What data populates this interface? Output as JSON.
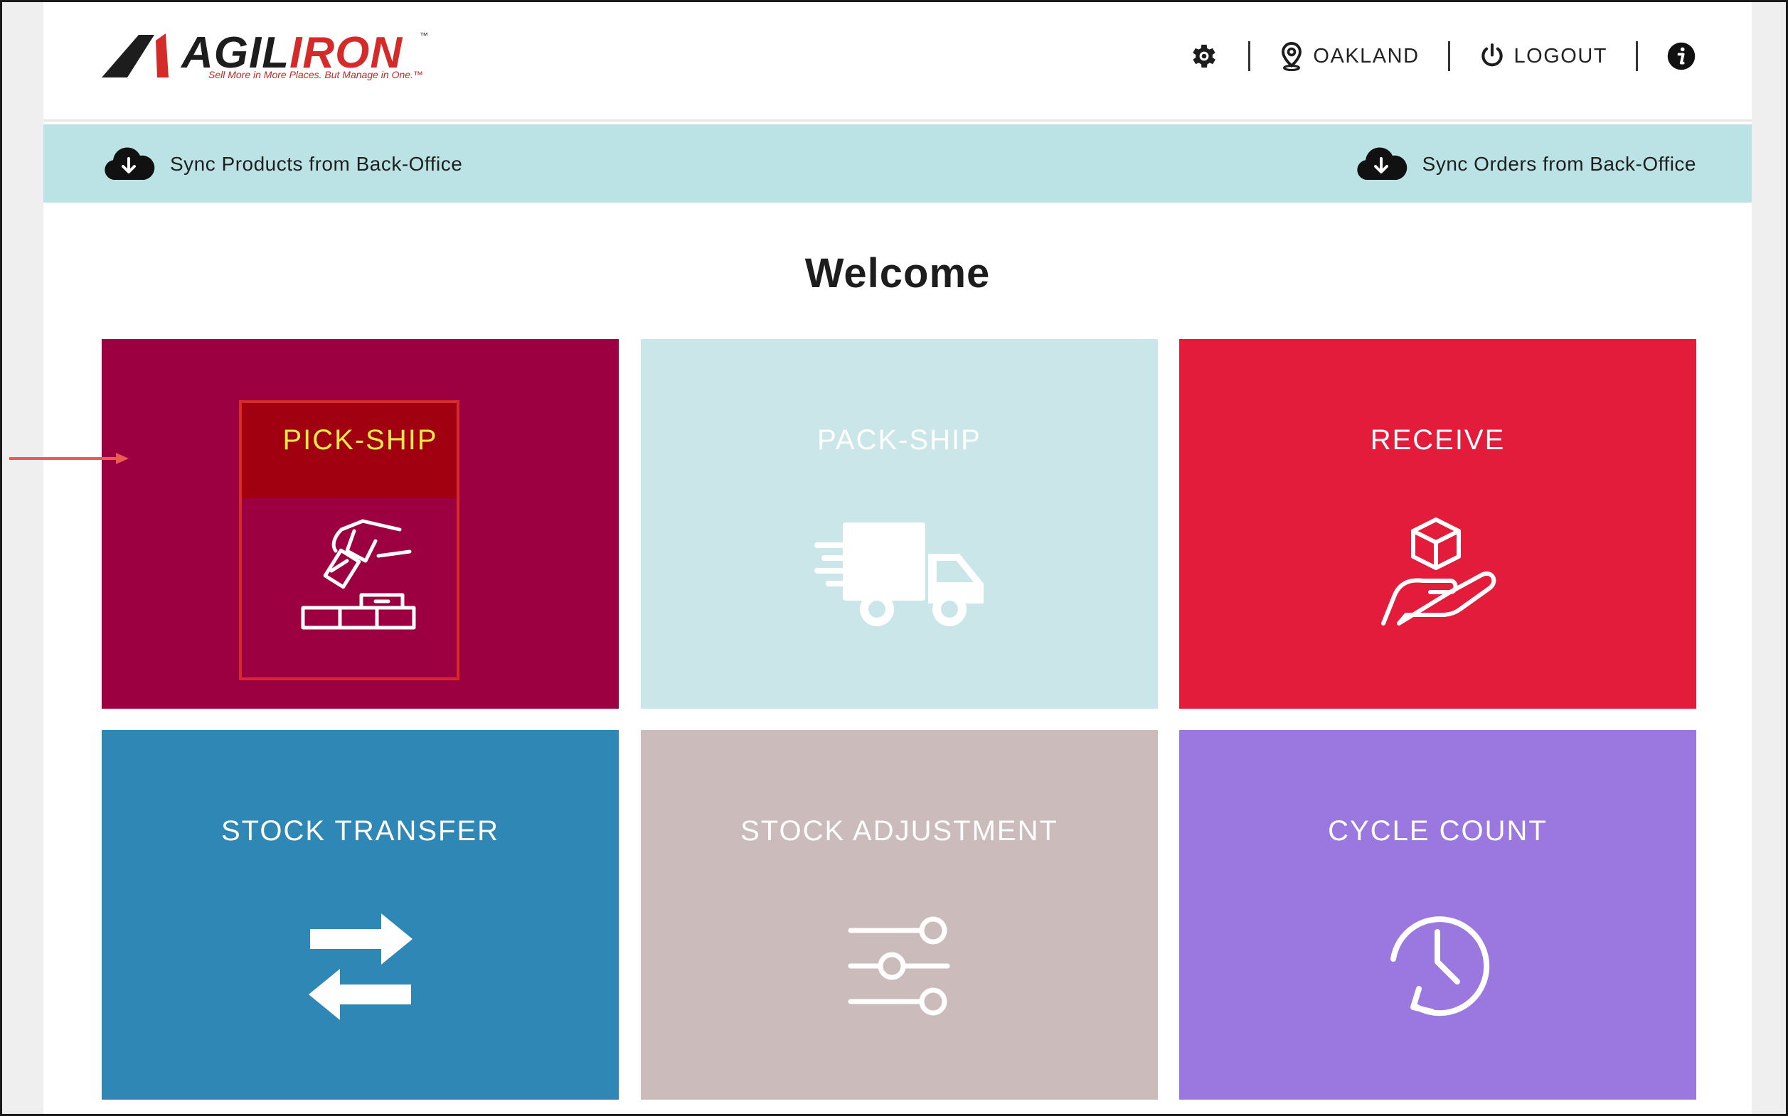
{
  "brand": {
    "name_dark": "AGIL",
    "name_red": "IRON",
    "tm": "™",
    "tagline": "Sell More in More Places. But Manage in One.™",
    "colors": {
      "dark": "#1d1d1d",
      "red": "#d42a2a"
    }
  },
  "header": {
    "settings_icon": "gear-icon",
    "location_label": "OAKLAND",
    "logout_label": "LOGOUT",
    "info_icon": "info-icon"
  },
  "sync": {
    "products_label": "Sync Products from Back-Office",
    "orders_label": "Sync Orders from Back-Office",
    "icon": "cloud-download-icon",
    "bar_color": "#bbe3e5"
  },
  "welcome": "Welcome",
  "tiles": [
    {
      "label": "PICK-SHIP",
      "icon": "pick-hand-icon",
      "color": "#9c0040",
      "selected": true
    },
    {
      "label": "PACK-SHIP",
      "icon": "delivery-truck-icon",
      "color": "#cbe6e8"
    },
    {
      "label": "RECEIVE",
      "icon": "box-hand-icon",
      "color": "#e21c3a"
    },
    {
      "label": "STOCK TRANSFER",
      "icon": "transfer-arrows-icon",
      "color": "#2e87b4"
    },
    {
      "label": "STOCK ADJUSTMENT",
      "icon": "sliders-icon",
      "color": "#cbbbbb"
    },
    {
      "label": "CYCLE COUNT",
      "icon": "clock-history-icon",
      "color": "#9b77e0"
    }
  ],
  "annotation": {
    "arrow_color": "#ef5a50",
    "highlight_color": "#d72b2b"
  }
}
